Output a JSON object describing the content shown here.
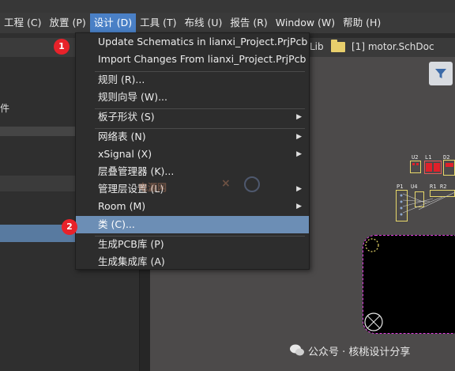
{
  "menubar": {
    "items": [
      {
        "label": "工程 (C)",
        "active": false
      },
      {
        "label": "放置 (P)",
        "active": false
      },
      {
        "label": "设计 (D)",
        "active": true
      },
      {
        "label": "工具 (T)",
        "active": false
      },
      {
        "label": "布线 (U)",
        "active": false
      },
      {
        "label": "报告 (R)",
        "active": false
      },
      {
        "label": "Window (W)",
        "active": false
      },
      {
        "label": "帮助 (H)",
        "active": false
      }
    ]
  },
  "left_panel": {
    "fragment_label": "件"
  },
  "doc_tabs": {
    "lib_tab": "Lib",
    "sch_tab": "[1] motor.SchDoc"
  },
  "design_menu": {
    "items": [
      {
        "label": "Update Schematics in lianxi_Project.PrjPcb",
        "submenu": false
      },
      {
        "label": "Import Changes From lianxi_Project.PrjPcb",
        "submenu": false
      },
      {
        "label": "规则 (R)...",
        "submenu": false
      },
      {
        "label": "规则向导 (W)...",
        "submenu": false
      },
      {
        "label": "板子形状 (S)",
        "submenu": true
      },
      {
        "label": "网络表 (N)",
        "submenu": true
      },
      {
        "label": "xSignal (X)",
        "submenu": true
      },
      {
        "label": "层叠管理器 (K)...",
        "submenu": false
      },
      {
        "label": "管理层设置 (L)",
        "submenu": true
      },
      {
        "label": "Room (M)",
        "submenu": true
      },
      {
        "label": "类 (C)...",
        "submenu": false,
        "highlight": true
      },
      {
        "label": "生成PCB库 (P)",
        "submenu": false
      },
      {
        "label": "生成集成库 (A)",
        "submenu": false
      }
    ]
  },
  "badges": [
    "1",
    "2"
  ],
  "pcb": {
    "designators": [
      "U2",
      "L1",
      "D2",
      "P1",
      "U4",
      "R1",
      "R2"
    ]
  },
  "watermark": {
    "left": "电源网",
    "right": "",
    "footer": "公众号 · 核桃设计分享"
  },
  "colors": {
    "accent": "#4a80c6",
    "highlight": "#6c8eb5",
    "badge": "#e8222a",
    "board_outline": "#e13fe1"
  },
  "icons": [
    "filter-icon",
    "folder-icon",
    "chevron-right-icon",
    "wechat-icon",
    "mount-hole-icon"
  ]
}
